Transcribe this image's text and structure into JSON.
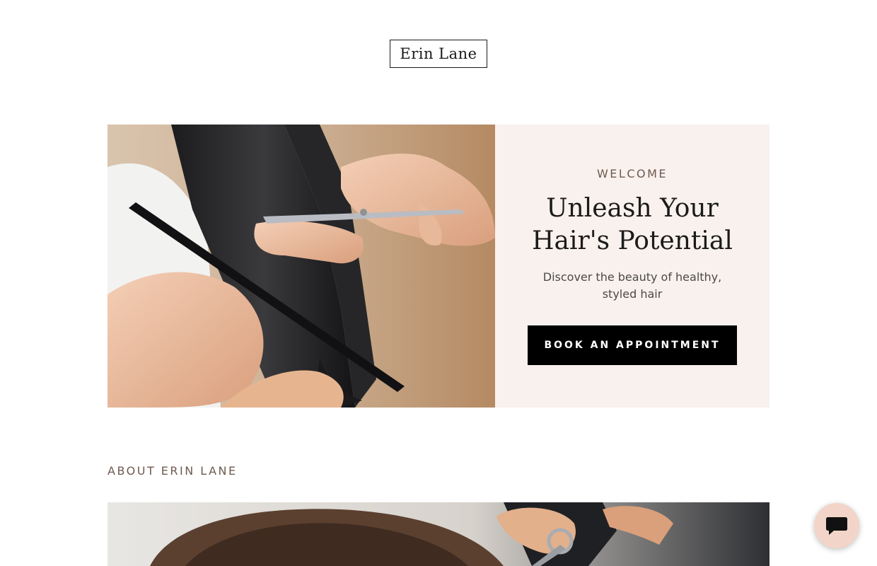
{
  "header": {
    "logo_text": "Erin Lane"
  },
  "hero": {
    "image_icon": "haircut-comb-scissors-photo",
    "eyebrow": "WELCOME",
    "headline": "Unleash Your Hair's Potential",
    "subtext": "Discover the beauty of healthy, styled hair",
    "cta_label": "BOOK AN APPOINTMENT",
    "panel_color": "#f9f1ee"
  },
  "about": {
    "heading": "ABOUT ERIN LANE",
    "image_icon": "barber-scissors-photo"
  },
  "chat": {
    "icon": "chat-bubble-icon",
    "color": "#f3d4c8"
  }
}
